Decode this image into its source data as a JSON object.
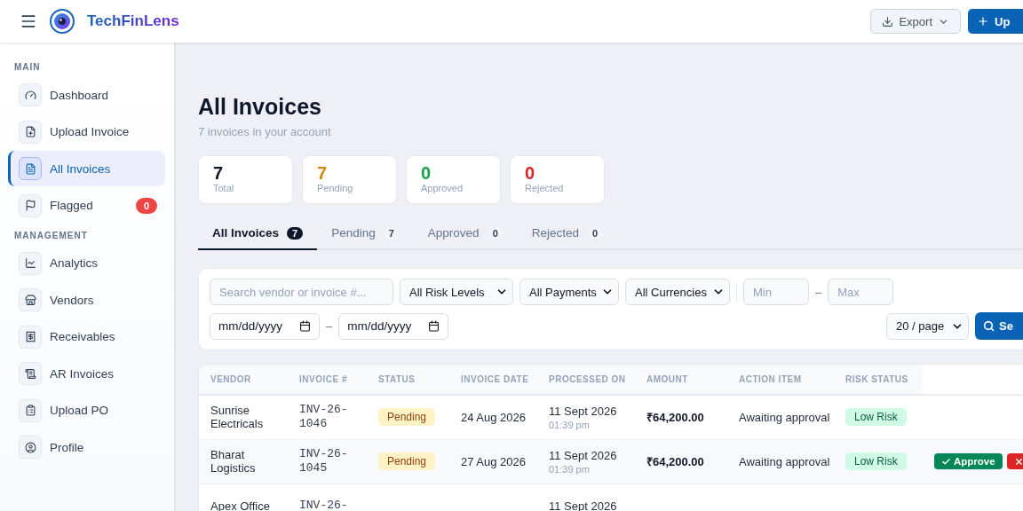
{
  "header": {
    "brand": "TechFinLens",
    "export_button": "Export",
    "upload_button": "Up"
  },
  "sidebar": {
    "sections": [
      {
        "title": "MAIN",
        "items": [
          {
            "label": "Dashboard",
            "selected": false
          },
          {
            "label": "Upload Invoice",
            "selected": false
          },
          {
            "label": "All Invoices",
            "selected": true
          },
          {
            "label": "Flagged",
            "selected": false,
            "badge": "0"
          }
        ]
      },
      {
        "title": "MANAGEMENT",
        "items": [
          {
            "label": "Analytics",
            "selected": false
          },
          {
            "label": "Vendors",
            "selected": false
          },
          {
            "label": "Receivables",
            "selected": false
          },
          {
            "label": "AR Invoices",
            "selected": false
          },
          {
            "label": "Upload PO",
            "selected": false
          },
          {
            "label": "Profile",
            "selected": false
          }
        ]
      }
    ]
  },
  "page": {
    "title": "All Invoices",
    "subtitle": "7 invoices in your account"
  },
  "stats": [
    {
      "value": "7",
      "label": "Total",
      "color": "#111827"
    },
    {
      "value": "7",
      "label": "Pending",
      "color": "#d08a0b"
    },
    {
      "value": "0",
      "label": "Approved",
      "color": "#16a34a"
    },
    {
      "value": "0",
      "label": "Rejected",
      "color": "#dc2626"
    }
  ],
  "tabs": [
    {
      "label": "All Invoices",
      "count": "7",
      "selected": true
    },
    {
      "label": "Pending",
      "count": "7",
      "selected": false
    },
    {
      "label": "Approved",
      "count": "0",
      "selected": false
    },
    {
      "label": "Rejected",
      "count": "0",
      "selected": false
    }
  ],
  "filters": {
    "search": {
      "placeholder": "Search vendor or invoice #..."
    },
    "selects": [
      "All Risk Levels",
      "All Payments",
      "All Currencies"
    ],
    "min": {
      "placeholder": "Min"
    },
    "max": {
      "placeholder": "Max"
    },
    "range_separator": "–",
    "date_from": "mm/dd/yyyy",
    "date_separator": "–",
    "date_to": "mm/dd/yyyy",
    "page_size": "20 / page",
    "search_button": "Se"
  },
  "table": {
    "columns": [
      "VENDOR",
      "INVOICE #",
      "STATUS",
      "INVOICE DATE",
      "PROCESSED ON",
      "AMOUNT",
      "ACTION ITEM",
      "RISK STATUS"
    ],
    "rows": [
      {
        "vendor": "Sunrise Electricals",
        "invoice": "INV-26-1046",
        "status": {
          "text": "Pending",
          "kind": "pending"
        },
        "invoice_date": "24 Aug 2026",
        "processed_date": "11 Sept 2026",
        "processed_time": "01:39 pm",
        "amount": "₹64,200.00",
        "action_item": "Awaiting approval",
        "risk": {
          "text": "Low Risk",
          "kind": "low"
        }
      },
      {
        "vendor": "Bharat Logistics",
        "invoice": "INV-26-1045",
        "status": {
          "text": "Pending",
          "kind": "pending"
        },
        "invoice_date": "27 Aug 2026",
        "processed_date": "11 Sept 2026",
        "processed_time": "01:39 pm",
        "amount": "₹64,200.00",
        "action_item": "Awaiting approval",
        "risk": {
          "text": "Low Risk",
          "kind": "low"
        },
        "actions": [
          {
            "kind": "approve",
            "label": "Approve"
          },
          {
            "kind": "reject"
          }
        ]
      },
      {
        "vendor": "Apex Office",
        "invoice": "INV-26-",
        "processed_date": "11 Sept 2026"
      }
    ]
  }
}
